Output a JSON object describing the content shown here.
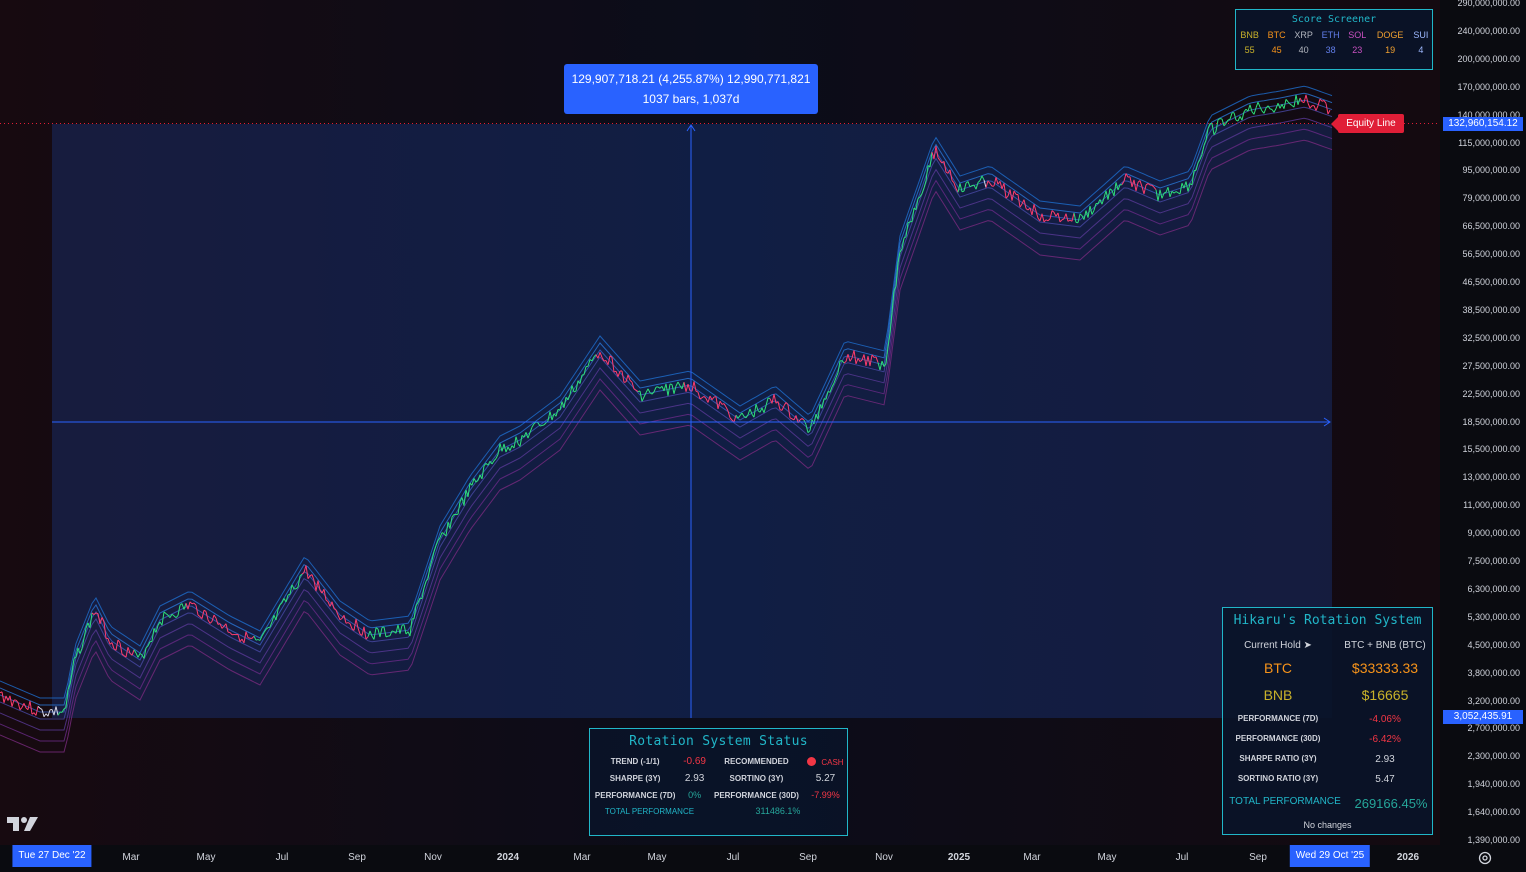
{
  "measurement": {
    "value_line": "129,907,718.21 (4,255.87%) 12,990,771,821",
    "bars_line": "1037 bars, 1,037d"
  },
  "equity_label": "Equity Line",
  "price_tags": {
    "equity_value": "132,960,154.12",
    "measure_low": "3,052,435.91"
  },
  "y_axis_ticks": [
    "290,000,000.00",
    "240,000,000.00",
    "200,000,000.00",
    "170,000,000.00",
    "140,000,000.00",
    "115,000,000.00",
    "95,000,000.00",
    "79,000,000.00",
    "66,500,000.00",
    "56,500,000.00",
    "46,500,000.00",
    "38,500,000.00",
    "32,500,000.00",
    "27,500,000.00",
    "22,500,000.00",
    "18,500,000.00",
    "15,500,000.00",
    "13,000,000.00",
    "11,000,000.00",
    "9,000,000.00",
    "7,500,000.00",
    "6,300,000.00",
    "5,300,000.00",
    "4,500,000.00",
    "3,800,000.00",
    "3,200,000.00",
    "2,700,000.00",
    "2,300,000.00",
    "1,940,000.00",
    "1,640,000.00",
    "1,390,000.00"
  ],
  "x_axis": {
    "start_tag": "Tue 27 Dec '22",
    "end_tag": "Wed 29 Oct '25",
    "ticks": [
      "Mar",
      "May",
      "Jul",
      "Sep",
      "Nov",
      "2024",
      "Mar",
      "May",
      "Jul",
      "Sep",
      "Nov",
      "2025",
      "Mar",
      "May",
      "Jul",
      "Sep",
      "2026"
    ]
  },
  "score_screener": {
    "title": "Score Screener",
    "assets": [
      {
        "symbol": "BNB",
        "score": "55",
        "color": "#c9b22a"
      },
      {
        "symbol": "BTC",
        "score": "45",
        "color": "#f7931a"
      },
      {
        "symbol": "XRP",
        "score": "40",
        "color": "#b2b5be"
      },
      {
        "symbol": "ETH",
        "score": "38",
        "color": "#627eea"
      },
      {
        "symbol": "SOL",
        "score": "23",
        "color": "#c850c0"
      },
      {
        "symbol": "DOGE",
        "score": "19",
        "color": "#f0a030"
      },
      {
        "symbol": "SUI",
        "score": "4",
        "color": "#9db8ff"
      }
    ]
  },
  "status": {
    "title": "Rotation System Status",
    "trend_label": "TREND (-1/1)",
    "trend_value": "-0.69",
    "recommended_label": "RECOMMENDED",
    "recommended_value": "CASH",
    "sharpe_label": "SHARPE (3Y)",
    "sharpe_value": "2.93",
    "sortino_label": "SORTINO (3Y)",
    "sortino_value": "5.27",
    "perf7_label": "PERFORMANCE (7D)",
    "perf7_value": "0%",
    "perf30_label": "PERFORMANCE (30D)",
    "perf30_value": "-7.99%",
    "total_label": "TOTAL PERFORMANCE",
    "total_value": "311486.1%"
  },
  "hikaru": {
    "title": "Hikaru's Rotation System",
    "hold_label": "Current Hold ➤",
    "hold_value": "BTC + BNB (BTC)",
    "btc_label": "BTC",
    "btc_value": "$33333.33",
    "bnb_label": "BNB",
    "bnb_value": "$16665",
    "perf7_label": "PERFORMANCE (7D)",
    "perf7_value": "-4.06%",
    "perf30_label": "PERFORMANCE (30D)",
    "perf30_value": "-6.42%",
    "sharpe_label": "SHARPE RATIO (3Y)",
    "sharpe_value": "2.93",
    "sortino_label": "SORTINO RATIO (3Y)",
    "sortino_value": "5.47",
    "total_label": "TOTAL PERFORMANCE",
    "total_value": "269166.45%",
    "changes": "No changes"
  },
  "colors": {
    "accent": "#2962ff",
    "panel_border": "#21b6c8",
    "equity_red": "#e01e37",
    "negative": "#f23645",
    "positive": "#26a69a"
  }
}
